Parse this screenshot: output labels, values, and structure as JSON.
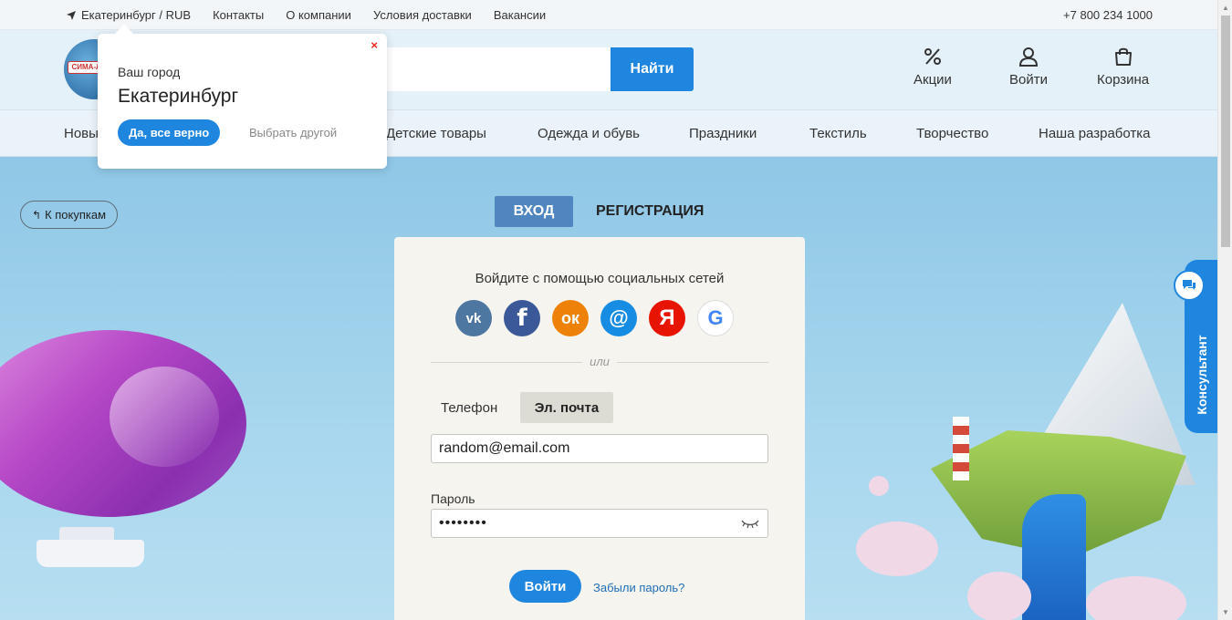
{
  "topbar": {
    "city": "Екатеринбург / RUB",
    "links": [
      "Контакты",
      "О компании",
      "Условия доставки",
      "Вакансии"
    ],
    "phone": "+7 800 234 1000"
  },
  "header": {
    "logo_text": "СИМА-ЛЕНД",
    "search_button": "Найти",
    "actions": {
      "promo": "Акции",
      "login": "Войти",
      "cart": "Корзина"
    }
  },
  "categories": {
    "first_partial": "Новы",
    "items": [
      "Детские товары",
      "Одежда и обувь",
      "Праздники",
      "Текстиль",
      "Творчество",
      "Наша разработка"
    ]
  },
  "city_popup": {
    "label": "Ваш город",
    "city": "Екатеринбург",
    "confirm": "Да, все верно",
    "choose_other": "Выбрать другой",
    "close": "×"
  },
  "back_button": "К покупкам",
  "auth_tabs": {
    "login": "ВХОД",
    "register": "РЕГИСТРАЦИЯ"
  },
  "login_card": {
    "social_title": "Войдите с помощью социальных сетей",
    "socials": [
      {
        "name": "vk",
        "glyph": "vk"
      },
      {
        "name": "facebook",
        "glyph": "f"
      },
      {
        "name": "odnoklassniki",
        "glyph": "ок"
      },
      {
        "name": "mail",
        "glyph": "@"
      },
      {
        "name": "yandex",
        "glyph": "Я"
      },
      {
        "name": "google",
        "glyph": "G"
      }
    ],
    "or": "или",
    "tab_phone": "Телефон",
    "tab_email": "Эл. почта",
    "email_value": "random@email.com",
    "password_label": "Пароль",
    "password_value": "••••••••",
    "submit": "Войти",
    "forgot": "Забыли пароль?"
  },
  "consultant": "Консультант",
  "colors": {
    "accent": "#1f86e0",
    "tab_active": "#4f86bf",
    "background": "#9cd0ea"
  }
}
